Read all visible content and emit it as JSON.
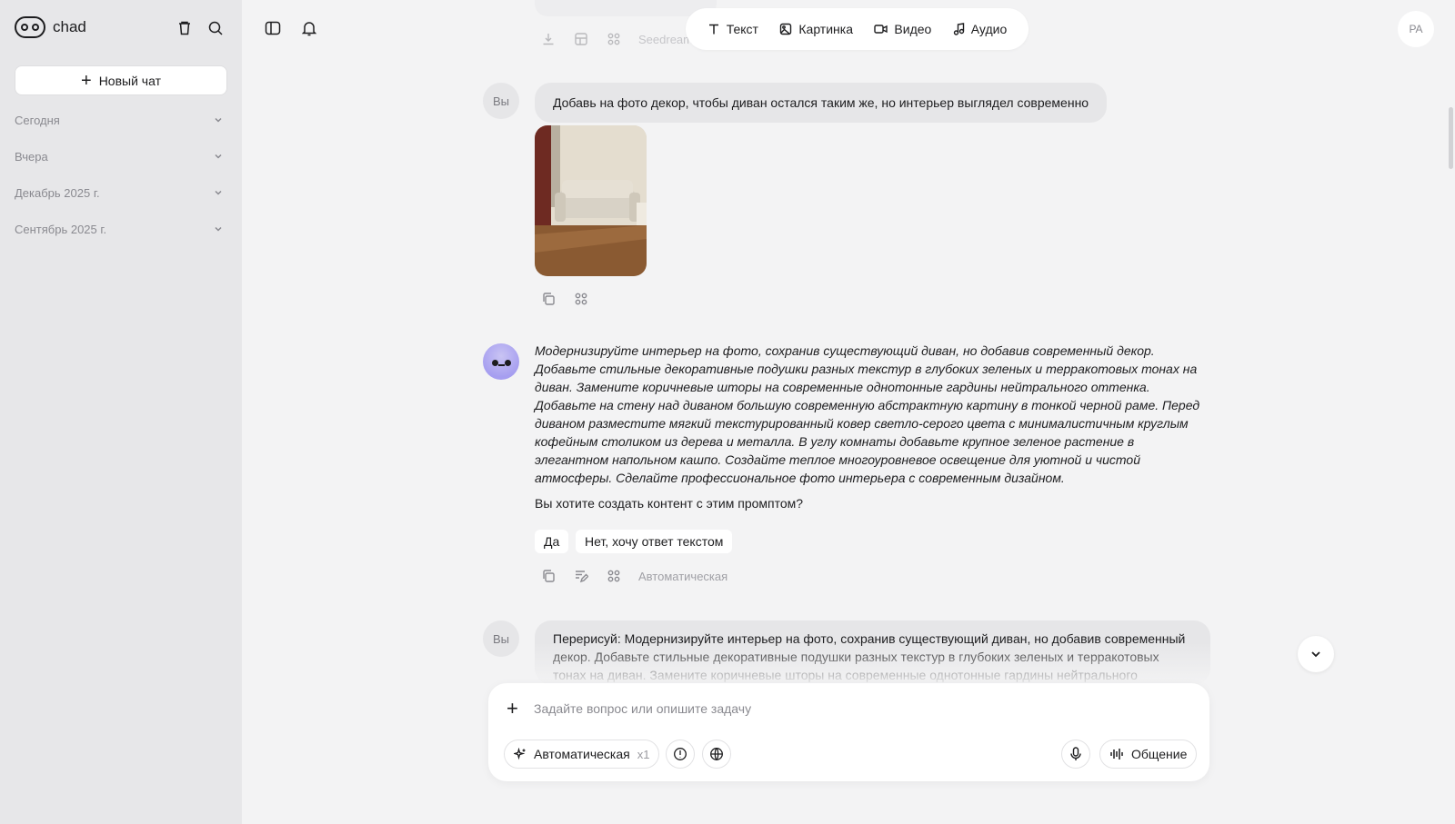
{
  "sidebar": {
    "app_name": "chad",
    "new_chat_label": "Новый чат",
    "groups": [
      {
        "label": "Сегодня"
      },
      {
        "label": "Вчера"
      },
      {
        "label": "Декабрь 2025 г."
      },
      {
        "label": "Сентябрь 2025 г."
      }
    ]
  },
  "mode_bar": {
    "items": [
      {
        "label": "Текст",
        "icon": "text-icon"
      },
      {
        "label": "Картинка",
        "icon": "image-icon"
      },
      {
        "label": "Видео",
        "icon": "video-icon"
      },
      {
        "label": "Аудио",
        "icon": "audio-icon"
      }
    ]
  },
  "user": {
    "initials": "PA"
  },
  "prev_message": {
    "model_label": "Seedream"
  },
  "messages": {
    "you_label": "Вы",
    "user_message_1": "Добавь на фото декор, чтобы диван остался таким же, но интерьер выглядел современно",
    "bot_prompt": "Модернизируйте интерьер на фото, сохранив существующий диван, но добавив современный декор. Добавьте стильные декоративные подушки разных текстур в глубоких зеленых и терракотовых тонах на диван. Замените коричневые шторы на современные однотонные гардины нейтрального оттенка. Добавьте на стену над диваном большую современную абстрактную картину в тонкой черной раме. Перед диваном разместите мягкий текстурированный ковер светло-серого цвета с минималистичным круглым кофейным столиком из дерева и металла. В углу комнаты добавьте крупное зеленое растение в элегантном напольном кашпо. Создайте теплое многоуровневое освещение для уютной и чистой атмосферы. Сделайте профессиональное фото интерьера с современным дизайном.",
    "bot_question": "Вы хотите создать контент с этим промптом?",
    "choice_yes": "Да",
    "choice_no": "Нет, хочу ответ текстом",
    "bot_model_label": "Автоматическая",
    "user_message_2": "Перерисуй: Модернизируйте интерьер на фото, сохранив существующий диван, но добавив современный декор. Добавьте стильные декоративные подушки разных текстур в глубоких зеленых и терракотовых тонах на диван. Замените коричневые шторы на современные однотонные гардины нейтрального"
  },
  "composer": {
    "placeholder": "Задайте вопрос или опишите задачу",
    "model_label": "Автоматическая",
    "multiplier": "x1",
    "voice_label": "Общение"
  }
}
